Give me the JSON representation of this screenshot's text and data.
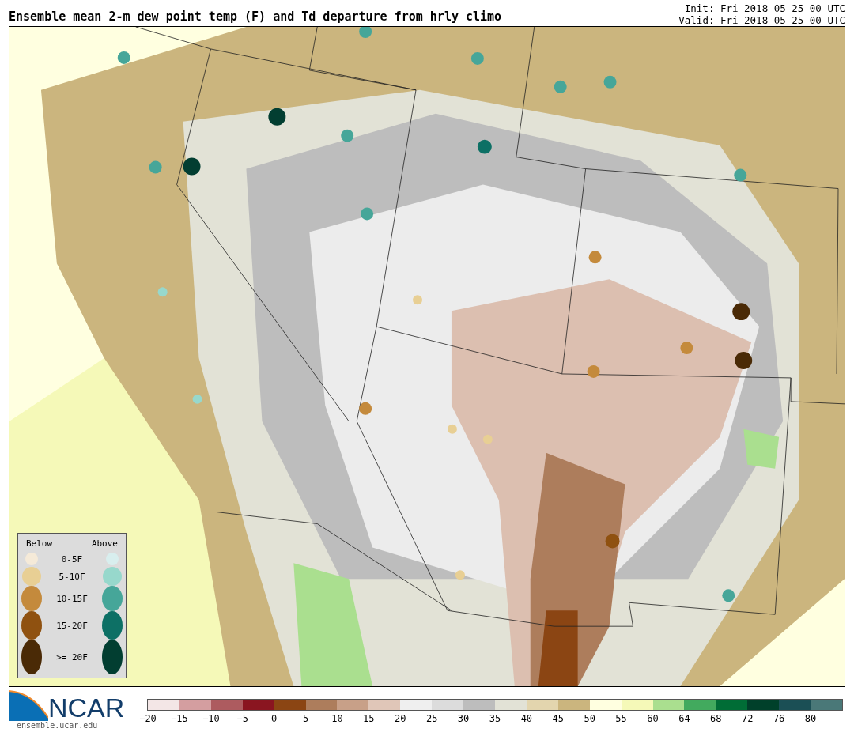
{
  "title": "Ensemble mean 2-m dew point temp (F) and Td departure from hrly climo",
  "init": "Init: Fri 2018-05-25 00 UTC",
  "valid": "Valid: Fri 2018-05-25 00 UTC",
  "legend": {
    "below_label": "Below",
    "above_label": "Above",
    "rows": [
      {
        "label": "0-5F",
        "below": {
          "color": "#f5ead8"
        },
        "above": {
          "color": "#d8eeee"
        }
      },
      {
        "label": "5-10F",
        "below": {
          "color": "#e8cf94"
        },
        "above": {
          "color": "#97d8cc"
        }
      },
      {
        "label": "10-15F",
        "below": {
          "color": "#c48a3c"
        },
        "above": {
          "color": "#46a699"
        }
      },
      {
        "label": "15-20F",
        "below": {
          "color": "#8f5110"
        },
        "above": {
          "color": "#0d7065"
        }
      },
      {
        "label": ">= 20F",
        "below": {
          "color": "#4a2a06"
        },
        "above": {
          "color": "#023e31"
        }
      }
    ]
  },
  "logo": {
    "name": "NCAR",
    "url": "ensemble.ucar.edu"
  },
  "colorbar": {
    "segments": [
      {
        "color": "#f3e6e6",
        "tick": "−20"
      },
      {
        "color": "#d49ea0",
        "tick": "−15"
      },
      {
        "color": "#ad5b5f",
        "tick": "−10"
      },
      {
        "color": "#8a1520",
        "tick": "−5"
      },
      {
        "color": "#8b4513",
        "tick": "0"
      },
      {
        "color": "#ad7d5c",
        "tick": "5"
      },
      {
        "color": "#c8a088",
        "tick": "10"
      },
      {
        "color": "#e0c6b8",
        "tick": "15"
      },
      {
        "color": "#efefef",
        "tick": "20"
      },
      {
        "color": "#dcdcdc",
        "tick": "25"
      },
      {
        "color": "#bdbdbd",
        "tick": "30"
      },
      {
        "color": "#e2e2d6",
        "tick": "35"
      },
      {
        "color": "#e3d5ae",
        "tick": "40"
      },
      {
        "color": "#cbb57e",
        "tick": "45"
      },
      {
        "color": "#ffffe0",
        "tick": "50"
      },
      {
        "color": "#f5f9b8",
        "tick": "55"
      },
      {
        "color": "#aadf8f",
        "tick": "60"
      },
      {
        "color": "#42aa5e",
        "tick": "64"
      },
      {
        "color": "#006d36",
        "tick": "68"
      },
      {
        "color": "#00402a",
        "tick": "72"
      },
      {
        "color": "#1b4f55",
        "tick": "76"
      },
      {
        "color": "#4a7878",
        "tick": "80"
      }
    ]
  }
}
